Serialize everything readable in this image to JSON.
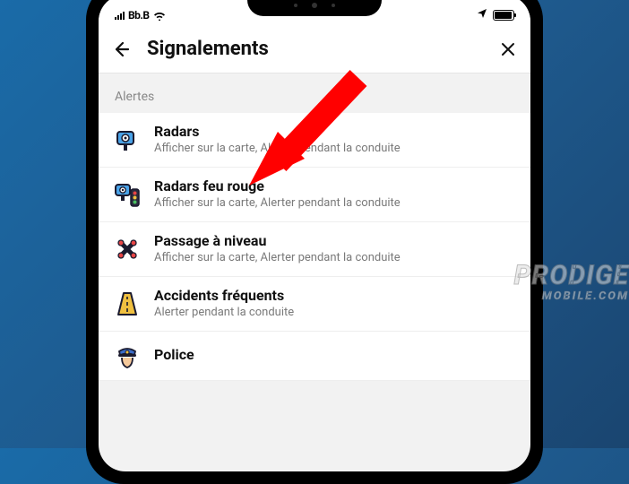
{
  "status": {
    "carrier": "Bb.B"
  },
  "header": {
    "title": "Signalements"
  },
  "section": {
    "label": "Alertes"
  },
  "items": [
    {
      "title": "Radars",
      "sub": "Afficher sur la carte, Alerter pendant la conduite",
      "icon": "camera"
    },
    {
      "title": "Radars feu rouge",
      "sub": "Afficher sur la carte, Alerter pendant la conduite",
      "icon": "camera-light"
    },
    {
      "title": "Passage à niveau",
      "sub": "Afficher sur la carte, Alerter pendant la conduite",
      "icon": "crossing"
    },
    {
      "title": "Accidents fréquents",
      "sub": "Alerter pendant la conduite",
      "icon": "road"
    },
    {
      "title": "Police",
      "sub": "",
      "icon": "police"
    }
  ],
  "watermark": {
    "line1": "PRODIGE",
    "line2": "MOBILE.COM"
  }
}
